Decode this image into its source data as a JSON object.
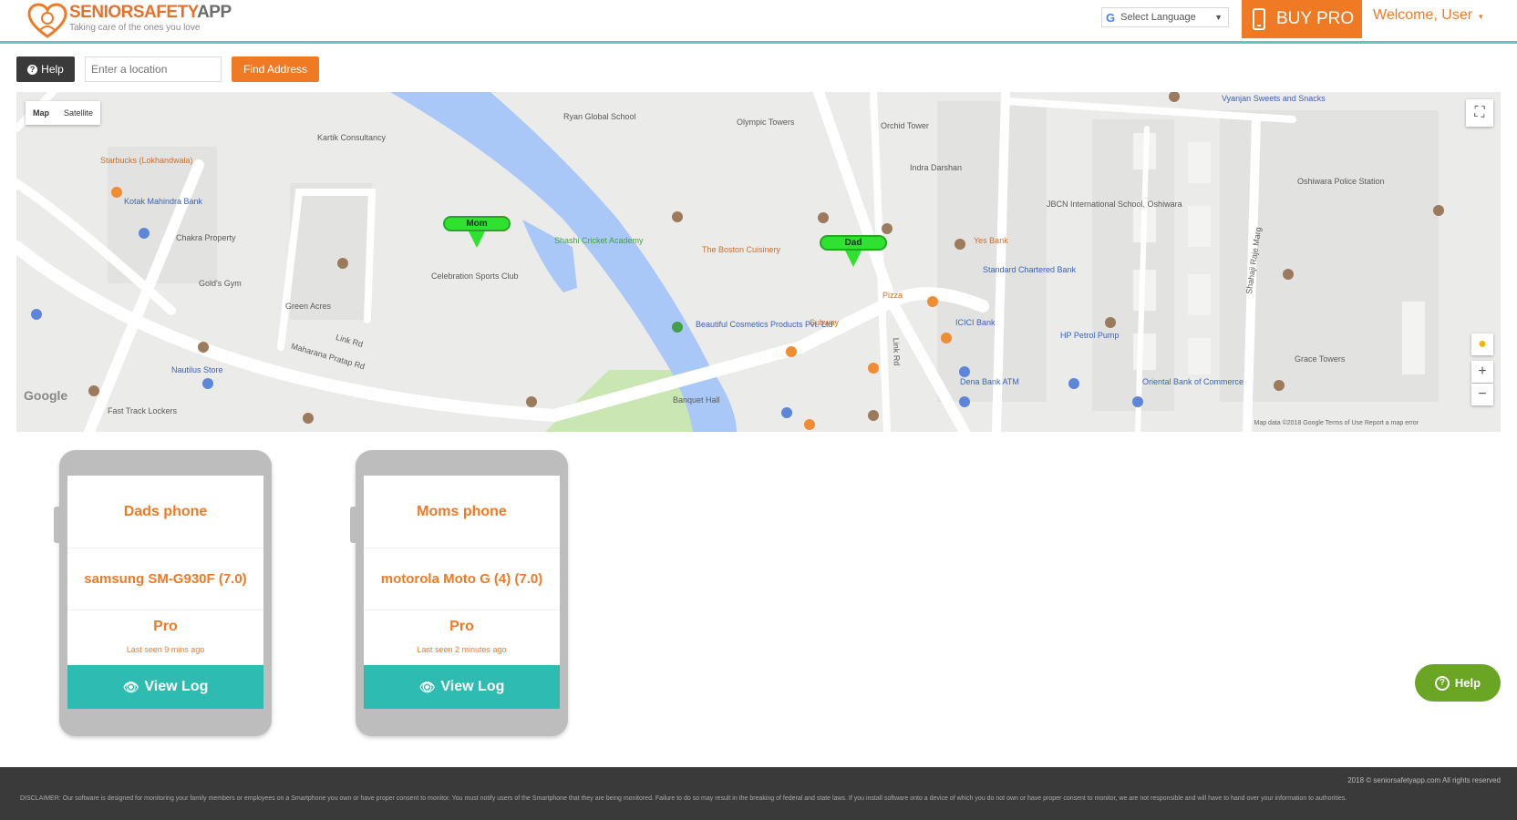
{
  "header": {
    "logo_brand_a": "SENIORSAFETY",
    "logo_brand_b": "APP",
    "logo_tagline": "Taking care of the ones you love",
    "language_label": "Select Language",
    "buy_pro_label": "BUY PRO",
    "welcome_label": "Welcome, User"
  },
  "toolbar": {
    "help_label": "Help",
    "location_placeholder": "Enter a location",
    "find_address_label": "Find Address"
  },
  "map": {
    "toggle": [
      "Map",
      "Satellite"
    ],
    "markers": [
      {
        "label": "Mom"
      },
      {
        "label": "Dad"
      }
    ],
    "labels": [
      "Ryan Global School",
      "Olympic Towers",
      "Orchid Tower",
      "Kartik Consultancy",
      "Starbucks (Lokhandwala)",
      "Kotak Mahindra Bank",
      "Chakra Property",
      "Celebration Sports Club",
      "Gold's Gym",
      "Green Acres",
      "Shashi Cricket Academy",
      "The Boston Cuisinery",
      "Indra Darshan",
      "JBCN International School, Oshiwara",
      "Standard Chartered Bank",
      "Yes Bank",
      "Beautiful Cosmetics Products Pvt. Ltd",
      "Subway",
      "Pizza",
      "ICICI Bank",
      "HP Petrol Pump",
      "Dena Bank ATM",
      "Oriental Bank of Commerce",
      "Oshiwara Police Station",
      "Grace Towers",
      "Maharana Pratap Rd",
      "Link Rd",
      "Nautilus Store",
      "Fast Track Lockers",
      "Banquet Hall",
      "Shahaji Raje Marg",
      "Link Rd",
      "Vyanjan Sweets and Snacks"
    ],
    "google_label": "Google",
    "footer_label": "Map data ©2018 Google   Terms of Use   Report a map error"
  },
  "devices": [
    {
      "name": "Dads phone",
      "model": "samsung SM-G930F (7.0)",
      "plan": "Pro",
      "last_seen": "Last seen 9 mins ago",
      "view_log_label": "View Log"
    },
    {
      "name": "Moms phone",
      "model": "motorola Moto G (4) (7.0)",
      "plan": "Pro",
      "last_seen": "Last seen 2 minutes ago",
      "view_log_label": "View Log"
    }
  ],
  "floating_help_label": "Help",
  "footer": {
    "copyright": "2018 © seniorsafetyapp.com All rights reserved",
    "disclaimer": "DISCLAIMER: Our software is designed for monitoring your family members or employees on a Smartphone you own or have proper consent to monitor. You must notify users of the Smartphone that they are being monitored. Failure to do so may result in the breaking of federal and state laws. If you install software onto a device of which you do not own or have proper consent to monitor, we are not responsible and will have to hand over your information to authorities."
  },
  "colors": {
    "accent_orange": "#f07a23",
    "teal": "#2ebcb2",
    "help_green": "#6aa524",
    "marker_green": "#2fe22f"
  }
}
